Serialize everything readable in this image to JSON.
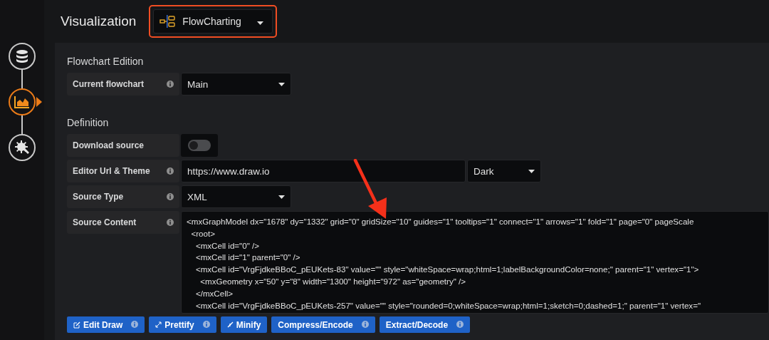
{
  "header": {
    "title": "Visualization",
    "picker": {
      "label": "FlowCharting"
    }
  },
  "steps": [
    {
      "kind": "database",
      "selected": false
    },
    {
      "kind": "chart",
      "selected": true
    },
    {
      "kind": "settings",
      "selected": false
    }
  ],
  "sections": [
    {
      "title": "Flowchart Edition",
      "rows": [
        {
          "kind": "select",
          "label": "Current flowchart",
          "info": true,
          "value": "Main"
        }
      ]
    },
    {
      "title": "Definition",
      "rows": [
        {
          "kind": "switch",
          "label": "Download source",
          "info": false,
          "on": false
        },
        {
          "kind": "input-select",
          "label": "Editor Url & Theme",
          "info": true,
          "value": "https://www.draw.io",
          "option": "Dark"
        },
        {
          "kind": "select",
          "label": "Source Type",
          "info": true,
          "value": "XML"
        },
        {
          "kind": "code",
          "label": "Source Content",
          "info": true,
          "lines": [
            "<mxGraphModel dx=\"1678\" dy=\"1332\" grid=\"0\" gridSize=\"10\" guides=\"1\" tooltips=\"1\" connect=\"1\" arrows=\"1\" fold=\"1\" page=\"0\" pageScale",
            "  <root>",
            "    <mxCell id=\"0\" />",
            "    <mxCell id=\"1\" parent=\"0\" />",
            "    <mxCell id=\"VrgFjdkeBBoC_pEUKets-83\" value=\"\" style=\"whiteSpace=wrap;html=1;labelBackgroundColor=none;\" parent=\"1\" vertex=\"1\">",
            "      <mxGeometry x=\"50\" y=\"8\" width=\"1300\" height=\"972\" as=\"geometry\" />",
            "    </mxCell>",
            "    <mxCell id=\"VrgFjdkeBBoC_pEUKets-257\" value=\"\" style=\"rounded=0;whiteSpace=wrap;html=1;sketch=0;dashed=1;\" parent=\"1\" vertex=\""
          ]
        }
      ]
    }
  ],
  "buttons": [
    {
      "kind": "edit",
      "label": "Edit Draw",
      "info": true
    },
    {
      "kind": "prettify",
      "label": "Prettify",
      "info": true
    },
    {
      "kind": "minify",
      "label": "Minify",
      "info": false
    },
    {
      "kind": "none",
      "label": "Compress/Encode",
      "info": true
    },
    {
      "kind": "none",
      "label": "Extract/Decode",
      "info": true
    }
  ]
}
